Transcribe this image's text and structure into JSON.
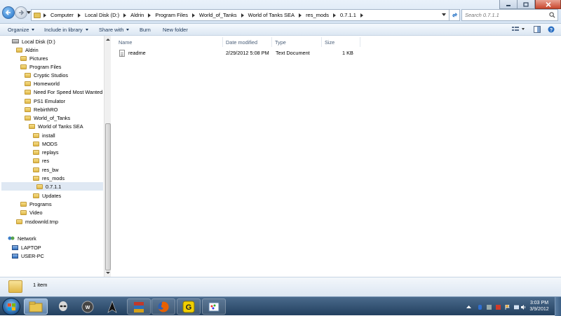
{
  "address": {
    "crumbs": [
      "Computer",
      "Local Disk (D:)",
      "Aldrin",
      "Program Files",
      "World_of_Tanks",
      "World of Tanks SEA",
      "res_mods",
      "0.7.1.1"
    ]
  },
  "search": {
    "placeholder": "Search 0.7.1.1"
  },
  "toolbar": {
    "organize": "Organize",
    "include_in_library": "Include in library",
    "share_with": "Share with",
    "burn": "Burn",
    "new_folder": "New folder"
  },
  "nav": {
    "local_disk": "Local Disk (D:)",
    "aldrin": "Aldrin",
    "pictures": "Pictures",
    "program_files": "Program Files",
    "cryptic_studios": "Cryptic Studios",
    "homeworld": "Homeworld",
    "nfs_most_wanted": "Need For Speed Most Wanted",
    "ps1_emulator": "PS1 Emulator",
    "rebirthro": "RebirthRO",
    "world_of_tanks": "World_of_Tanks",
    "world_of_tanks_sea": "World of Tanks SEA",
    "install": "install",
    "mods": "MODS",
    "replays": "replays",
    "res": "res",
    "res_bw": "res_bw",
    "res_mods": "res_mods",
    "v0711": "0.7.1.1",
    "updates": "Updates",
    "programs": "Programs",
    "video": "Video",
    "msdownld": "msdownld.tmp",
    "network": "Network",
    "laptop": "LAPTOP",
    "user_pc": "USER-PC"
  },
  "columns": {
    "name": "Name",
    "date_modified": "Date modified",
    "type": "Type",
    "size": "Size"
  },
  "files": [
    {
      "name": "readme",
      "date": "2/29/2012 5:08 PM",
      "type": "Text Document",
      "size": "1 KB"
    }
  ],
  "details": {
    "count": "1 item"
  },
  "clock": {
    "time": "3:03 PM",
    "date": "3/9/2012"
  },
  "colors": {
    "accent": "#1f6fc5",
    "toolbar_text": "#1e395b",
    "taskbar": "#2d4a6b",
    "close_button": "#c9472e"
  },
  "icons": {
    "back": "back-arrow-icon",
    "forward": "forward-arrow-icon",
    "refresh": "refresh-icon",
    "search": "search-icon",
    "folder": "folder-icon",
    "text_file": "text-file-icon"
  }
}
